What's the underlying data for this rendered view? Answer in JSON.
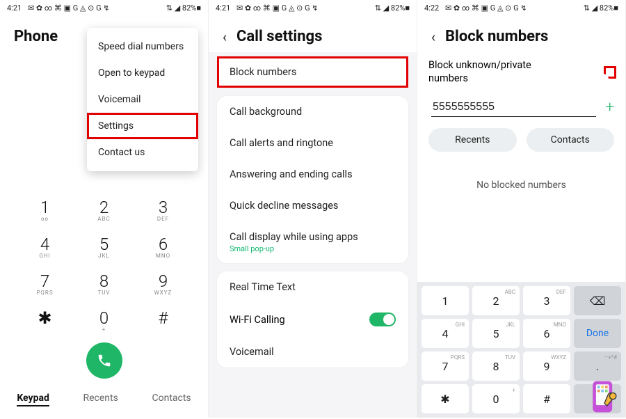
{
  "status": {
    "time_a": "4:21",
    "time_b": "4:21",
    "time_c": "4:22",
    "icons": "✉ ✿ ∞ ⌘ ▣ G ◬ ⊙ G ↯",
    "right": "⇅ ◢ 82%■"
  },
  "screen1": {
    "title": "Phone",
    "menu": [
      "Speed dial numbers",
      "Open to keypad",
      "Voicemail",
      "Settings",
      "Contact us"
    ],
    "highlight_index": 3,
    "keys": [
      {
        "d": "1",
        "l": "ᴏᴏ"
      },
      {
        "d": "2",
        "l": "ABC"
      },
      {
        "d": "3",
        "l": "DEF"
      },
      {
        "d": "4",
        "l": "GHI"
      },
      {
        "d": "5",
        "l": "JKL"
      },
      {
        "d": "6",
        "l": "MNO"
      },
      {
        "d": "7",
        "l": "PQRS"
      },
      {
        "d": "8",
        "l": "TUV"
      },
      {
        "d": "9",
        "l": "WXYZ"
      },
      {
        "d": "✱",
        "l": ""
      },
      {
        "d": "0",
        "l": "+"
      },
      {
        "d": "#",
        "l": ""
      }
    ],
    "tabs": [
      "Keypad",
      "Recents",
      "Contacts"
    ],
    "active_tab": 0
  },
  "screen2": {
    "title": "Call settings",
    "group1": [
      "Block numbers"
    ],
    "highlight_index": 0,
    "group2": [
      {
        "label": "Call background"
      },
      {
        "label": "Call alerts and ringtone"
      },
      {
        "label": "Answering and ending calls"
      },
      {
        "label": "Quick decline messages"
      },
      {
        "label": "Call display while using apps",
        "sub": "Small pop-up"
      }
    ],
    "group3": [
      {
        "label": "Real Time Text"
      },
      {
        "label": "Wi-Fi Calling",
        "toggle": true
      },
      {
        "label": "Voicemail"
      }
    ]
  },
  "screen3": {
    "title": "Block numbers",
    "toggle_label": "Block unknown/private numbers",
    "toggle_on": true,
    "input_value": "5555555555",
    "pills": [
      "Recents",
      "Contacts"
    ],
    "empty": "No blocked numbers",
    "numkeys": [
      {
        "d": "1",
        "s": ""
      },
      {
        "d": "2",
        "s": "ABC"
      },
      {
        "d": "3",
        "s": "DEF"
      },
      {
        "d": "⌫",
        "s": "",
        "func": true
      },
      {
        "d": "4",
        "s": "GHI"
      },
      {
        "d": "5",
        "s": "JKL"
      },
      {
        "d": "6",
        "s": "MNO"
      },
      {
        "d": "Done",
        "s": "",
        "func": true,
        "done": true
      },
      {
        "d": "7",
        "s": "PQRS"
      },
      {
        "d": "8",
        "s": "TUV"
      },
      {
        "d": "9",
        "s": "WXYZ"
      },
      {
        "d": ".",
        "s": "–+*#",
        "func": true
      },
      {
        "d": "✱",
        "s": ""
      },
      {
        "d": "0",
        "s": "+"
      },
      {
        "d": "#",
        "s": ""
      },
      {
        "d": "⌄",
        "s": "",
        "func": true
      }
    ]
  }
}
